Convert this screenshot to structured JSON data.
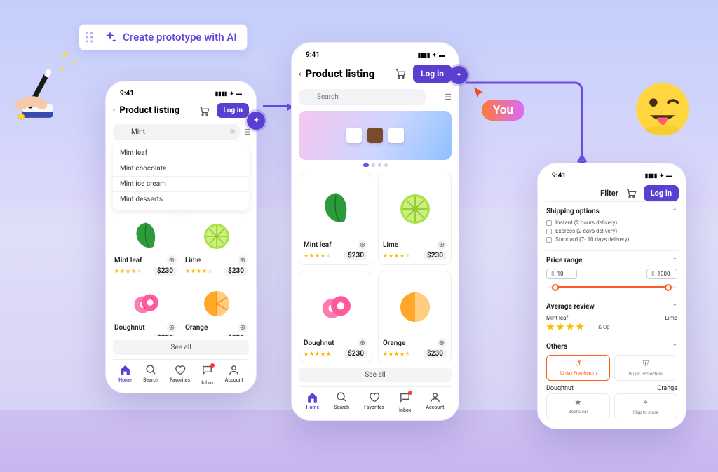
{
  "ai_pill": {
    "label": "Create prototype with AI"
  },
  "you_badge": "You",
  "status": {
    "time": "9:41"
  },
  "appbar": {
    "title": "Product listing",
    "login": "Log in"
  },
  "search": {
    "value_small": "Mint",
    "placeholder_large": "Search",
    "suggestions": [
      "Mint leaf",
      "Mint chocolate",
      "Mint ice cream",
      "Mint desserts"
    ]
  },
  "products": [
    {
      "name": "Mint leaf",
      "price": "$230",
      "rating": 4
    },
    {
      "name": "Lime",
      "price": "$230",
      "rating": 4
    },
    {
      "name": "Doughnut",
      "price": "$230",
      "rating": 5
    },
    {
      "name": "Orange",
      "price": "$230",
      "rating": 4.5
    }
  ],
  "see_all": "See all",
  "tabs": [
    "Home",
    "Search",
    "Favorites",
    "Inbox",
    "Account"
  ],
  "filter": {
    "label": "Filter",
    "sections": {
      "shipping": {
        "title": "Shipping options",
        "options": [
          "Instant (2 hours delivery)",
          "Express (2 days delivery)",
          "Standard (7- 10 days delivery)"
        ]
      },
      "price_range": {
        "title": "Price range",
        "min": "10",
        "max": "1000"
      },
      "review": {
        "title": "Average review",
        "and_up": "& Up",
        "over_left": "Mint leaf",
        "over_right": "Lime"
      },
      "others": {
        "title": "Others",
        "items": [
          "30 day Free Return",
          "Buyer Protection",
          "Best Deal",
          "Ship to store"
        ],
        "over_left": "Doughnut",
        "over_right": "Orange"
      }
    }
  }
}
